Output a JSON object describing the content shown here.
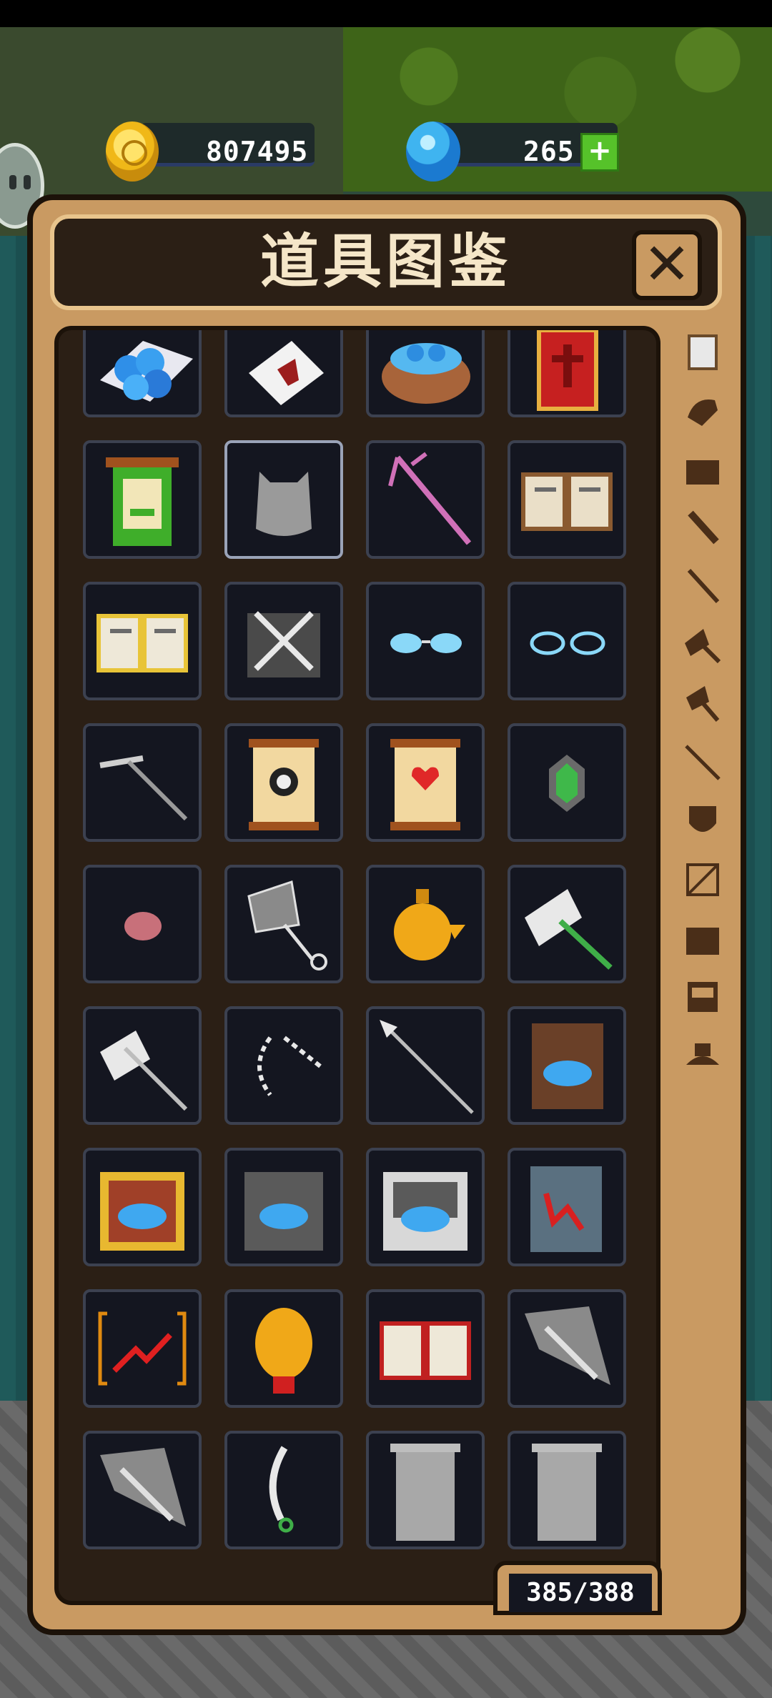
{
  "currency": {
    "coins": "807495",
    "gems": "265",
    "plus_label": "+"
  },
  "panel": {
    "title": "道具图鉴",
    "close_label": "✕",
    "counter": "385/388"
  },
  "sidebar_categories": [
    "all-items-icon",
    "glove-icon",
    "chest-icon",
    "sword-icon",
    "dagger-icon",
    "shovel-icon",
    "axe-icon",
    "spear-icon",
    "shield-icon",
    "bow-icon",
    "crate-icon",
    "box-icon",
    "hat-icon"
  ],
  "items": [
    [
      "blue-gems-bag-icon",
      "envelope-icon",
      "gem-basket-icon",
      "red-scroll-icon"
    ],
    [
      "green-scroll-icon",
      "grey-cloak-icon",
      "coral-staff-icon",
      "brown-book-icon"
    ],
    [
      "yellow-book-icon",
      "crossed-swords-chest-icon",
      "blue-glasses-icon",
      "outline-glasses-icon"
    ],
    [
      "rake-icon",
      "eye-scroll-icon",
      "heart-scroll-icon",
      "green-crystal-icon"
    ],
    [
      "meat-icon",
      "net-icon",
      "gold-pot-icon",
      "jade-hammer-icon"
    ],
    [
      "battle-axe-icon",
      "chain-icon",
      "silver-spear-icon",
      "wooden-chest-icon"
    ],
    [
      "golden-chest-icon",
      "iron-chest-icon",
      "silver-chest-icon",
      "red-rune-tablet-icon"
    ],
    [
      "boost-arrow-icon",
      "gold-medal-icon",
      "red-book-icon",
      "grey-blade-icon"
    ],
    [
      "grey-blade-2-icon",
      "scimitar-icon",
      "blank-scroll-icon",
      "blank-scroll-2-icon"
    ]
  ],
  "colors": {
    "panel": "#c99a62",
    "panel_dark": "#2b1f15",
    "cell_bg": "#141620",
    "cell_border": "#3c4150"
  }
}
